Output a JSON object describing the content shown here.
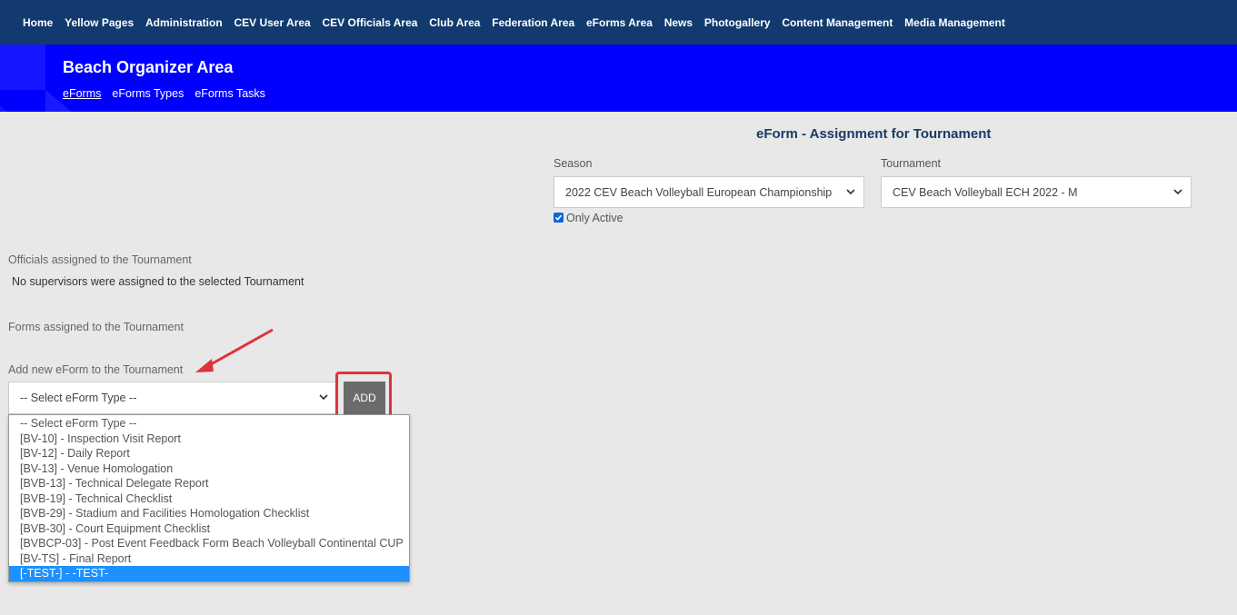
{
  "topnav": {
    "items": [
      "Home",
      "Yellow Pages",
      "Administration",
      "CEV User Area",
      "CEV Officials Area",
      "Club Area",
      "Federation Area",
      "eForms Area",
      "News",
      "Photogallery",
      "Content Management",
      "Media Management"
    ]
  },
  "banner": {
    "title": "Beach Organizer Area",
    "subnav": [
      "eForms",
      "eForms Types",
      "eForms Tasks"
    ],
    "active_subnav": "eForms"
  },
  "form": {
    "title": "eForm - Assignment for Tournament",
    "season_label": "Season",
    "season_value": "2022 CEV Beach Volleyball European Championship",
    "tournament_label": "Tournament",
    "tournament_value": "CEV Beach Volleyball ECH 2022 - M",
    "only_active_label": "Only Active",
    "only_active_checked": true
  },
  "officials": {
    "label": "Officials assigned to the Tournament",
    "empty_text": "No supervisors were assigned to the selected Tournament"
  },
  "forms_assigned": {
    "label": "Forms assigned to the Tournament"
  },
  "add_eform": {
    "label": "Add new eForm to the Tournament",
    "select_value": "-- Select eForm Type --",
    "button_label": "ADD",
    "options": [
      "-- Select eForm Type --",
      "[BV-10] - Inspection Visit Report",
      "[BV-12] - Daily Report",
      "[BV-13] - Venue Homologation",
      "[BVB-13] - Technical Delegate Report",
      "[BVB-19] - Technical Checklist",
      "[BVB-29] - Stadium and Facilities Homologation Checklist",
      "[BVB-30] - Court Equipment Checklist",
      "[BVBCP-03] - Post Event Feedback Form Beach Volleyball Continental CUP",
      "[BV-TS] - Final Report",
      "[-TEST-] - -TEST-"
    ],
    "highlighted_option": "[-TEST-] - -TEST-"
  },
  "colors": {
    "topnav_bg": "#133a6e",
    "banner_bg": "#0000ff",
    "highlight_red": "#e0333a",
    "option_selected": "#1e90ff"
  }
}
